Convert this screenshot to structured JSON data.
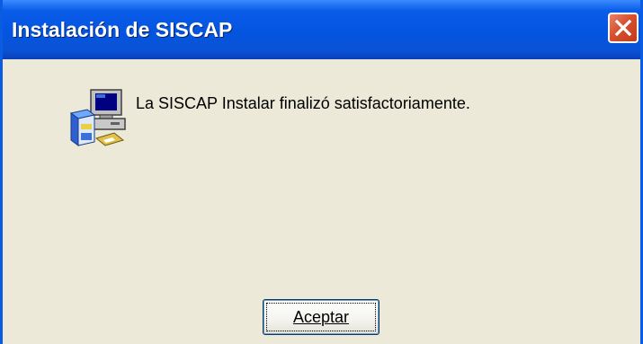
{
  "window": {
    "title": "Instalación de SISCAP",
    "close_icon": "close-icon"
  },
  "dialog": {
    "icon": "setup-computer-icon",
    "message": "La SISCAP Instalar finalizó satisfactoriamente.",
    "ok_button": {
      "label": "Aceptar",
      "accelerator": "A"
    }
  },
  "colors": {
    "titlebar": "#0454e0",
    "title_text": "#ffffff",
    "close_button": "#d6502f",
    "dialog_background": "#ece9d8",
    "button_border": "#003c74"
  }
}
